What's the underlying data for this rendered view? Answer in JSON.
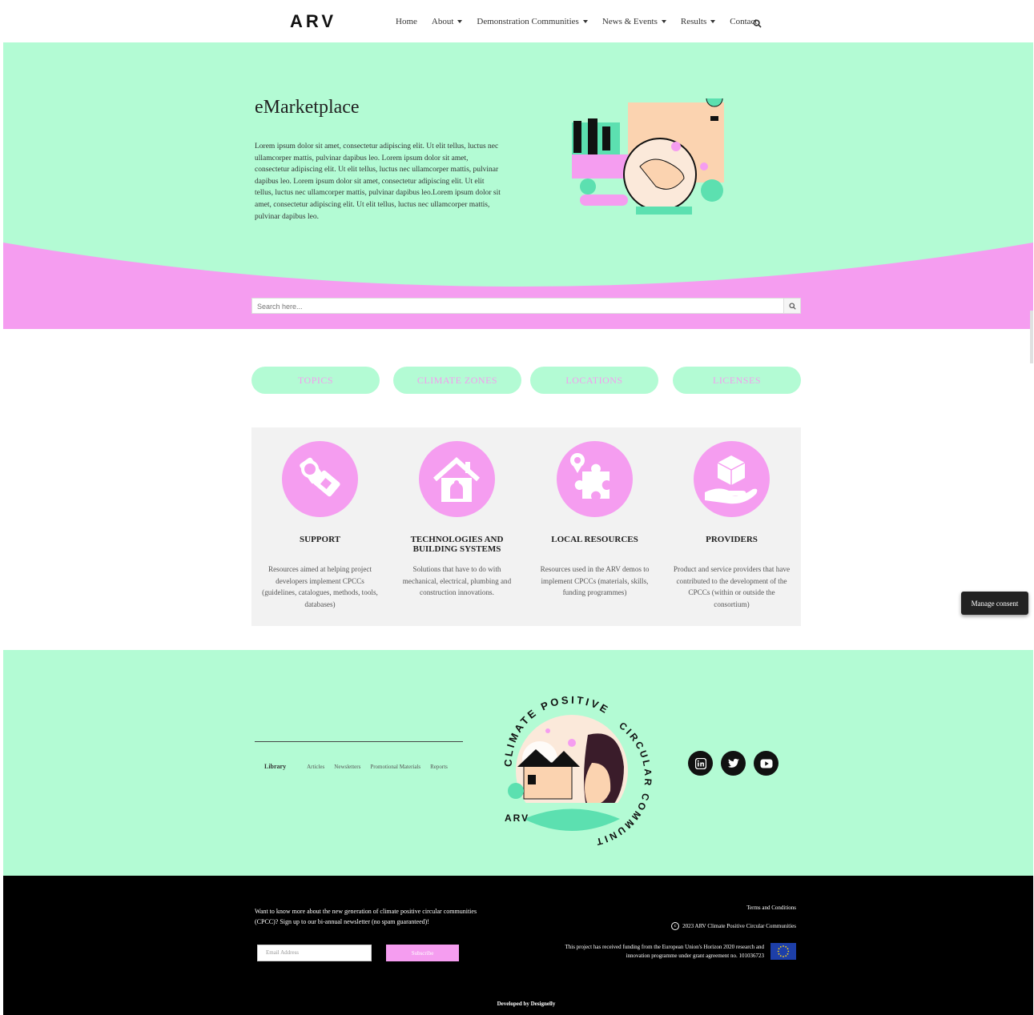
{
  "header": {
    "logo": "ARV",
    "nav": [
      {
        "label": "Home",
        "dropdown": false
      },
      {
        "label": "About",
        "dropdown": true
      },
      {
        "label": "Demonstration Communities",
        "dropdown": true
      },
      {
        "label": "News & Events",
        "dropdown": true
      },
      {
        "label": "Results",
        "dropdown": true
      },
      {
        "label": "Contact",
        "dropdown": false
      }
    ]
  },
  "hero": {
    "title": "eMarketplace",
    "text": "Lorem ipsum dolor sit amet, consectetur adipiscing elit. Ut elit tellus, luctus nec ullamcorper mattis, pulvinar dapibus leo. Lorem ipsum dolor sit amet, consectetur adipiscing elit. Ut elit tellus, luctus nec ullamcorper mattis, pulvinar dapibus leo. Lorem ipsum dolor sit amet, consectetur adipiscing elit. Ut elit tellus, luctus nec ullamcorper mattis, pulvinar dapibus leo.Lorem ipsum dolor sit amet, consectetur adipiscing elit. Ut elit tellus, luctus nec ullamcorper mattis, pulvinar dapibus leo.",
    "search_placeholder": "Search here..."
  },
  "tabs": [
    "TOPICS",
    "CLIMATE ZONES",
    "LOCATIONS",
    "LICENSES"
  ],
  "categories": [
    {
      "title": "SUPPORT",
      "desc": "Resources aimed at helping project developers implement CPCCs (guidelines, catalogues, methods, tools, databases)",
      "icon": "wrench-icon"
    },
    {
      "title": "TECHNOLOGIES AND BUILDING SYSTEMS",
      "desc": "Solutions that have to do with mechanical, electrical, plumbing and construction innovations.",
      "icon": "house-icon"
    },
    {
      "title": "LOCAL RESOURCES",
      "desc": "Resources used in the ARV demos to implement CPCCs (materials, skills, funding programmes)",
      "icon": "puzzle-icon"
    },
    {
      "title": "PROVIDERS",
      "desc": "Product and service providers that have contributed to the development of the CPCCs (within or outside the consortium)",
      "icon": "hand-box-icon"
    }
  ],
  "footer": {
    "library": "Library",
    "links": [
      "Articles",
      "Newsletters",
      "Promotional Materials",
      "Reports"
    ],
    "badge_top": "CLIMATE POSITIVE",
    "badge_side": "CIRCULAR COMMUNITIES",
    "badge_logo": "ARV",
    "newsletter_text": "Want to know more about the new generation of climate positive circular communities (CPCC)? Sign up to our bi-annual newsletter (no spam guaranteed)!",
    "email_placeholder": "Email Address",
    "subscribe": "Subscribe",
    "terms": "Terms and Conditions",
    "copyright": "2023 ARV Climate Positive Circular Communities",
    "funding": "This project has received funding from the European Union's Horizon 2020 research and innovation programme under grant agreement no. 101036723",
    "developed_by": "Developed by Designelly"
  },
  "consent": "Manage consent",
  "colors": {
    "mint": "#b3fbd4",
    "pink": "#f59df0",
    "black": "#000000"
  }
}
